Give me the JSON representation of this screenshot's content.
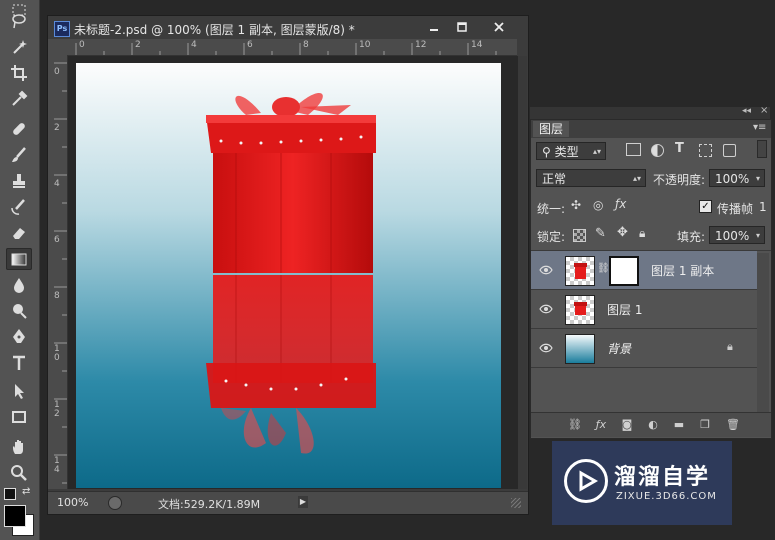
{
  "document": {
    "title": "未标题-2.psd @ 100% (图层 1 副本, 图层蒙版/8) *",
    "app_icon": "Ps",
    "ruler_top_marks": [
      "0",
      "2",
      "4",
      "6",
      "8",
      "10",
      "12",
      "14"
    ],
    "ruler_left_marks": [
      "0",
      "2",
      "4",
      "6",
      "8",
      "1\n0",
      "1\n2",
      "1\n4"
    ],
    "status": {
      "zoom": "100%",
      "doc_size": "文档:529.2K/1.89M"
    }
  },
  "layers_panel": {
    "tab_label": "图层",
    "filter_type": "类型",
    "blend_mode": "正常",
    "opacity_label": "不透明度:",
    "opacity_value": "100%",
    "unify_label": "统一:",
    "propagate_label": "传播帧",
    "propagate_value": "1",
    "propagate_checked": true,
    "lock_label": "锁定:",
    "fill_label": "填充:",
    "fill_value": "100%",
    "layers": [
      {
        "name": "图层 1 副本",
        "selected": true,
        "has_mask": true
      },
      {
        "name": "图层 1",
        "selected": false,
        "has_mask": false
      },
      {
        "name": "背景",
        "selected": false,
        "has_mask": false,
        "locked": true
      }
    ]
  },
  "watermark": {
    "title": "溜溜自学",
    "subtitle": "ZIXUE.3D66.COM"
  },
  "colors": {
    "canvas_top": "#fdfdfd",
    "canvas_bottom": "#0d6a89",
    "gift_red": "#e51c1c",
    "selected_layer": "#6e7787"
  }
}
